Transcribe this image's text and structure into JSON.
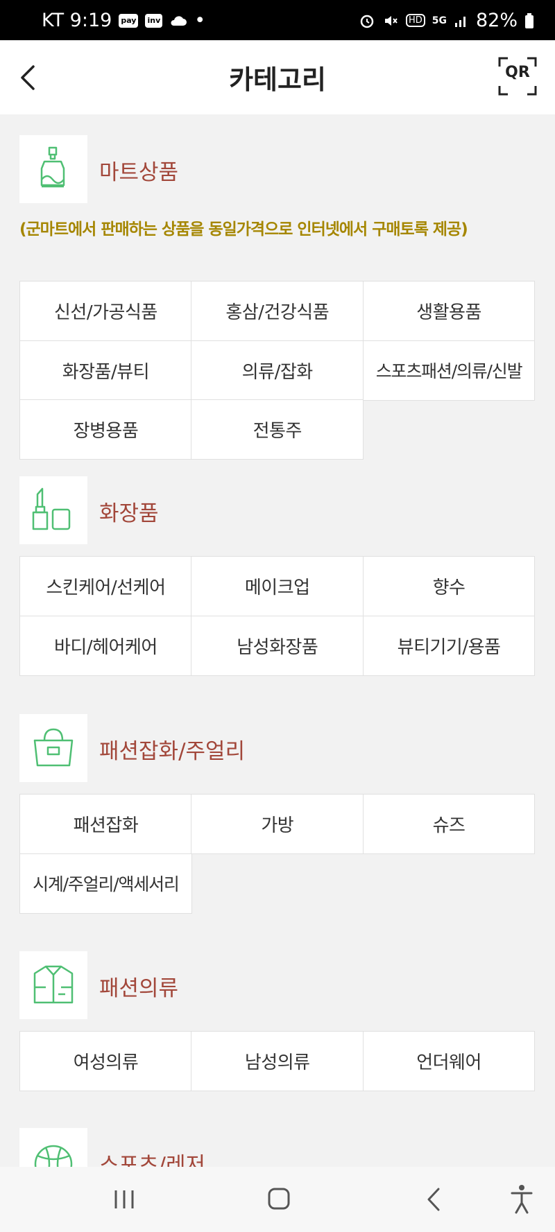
{
  "status_bar": {
    "carrier_time": "KT 9:19",
    "badge_pay": "pay",
    "badge_inv": "inv",
    "dot": "•",
    "hd": "HD",
    "network": "5G",
    "battery": "82%"
  },
  "header": {
    "title": "카테고리",
    "qr_label": "QR"
  },
  "sections": [
    {
      "title": "마트상품",
      "note": "(군마트에서 판매하는 상품을 동일가격으로 인터넷에서 구매토록 제공)",
      "items": [
        "신선/가공식품",
        "홍삼/건강식품",
        "생활용품",
        "화장품/뷰티",
        "의류/잡화",
        "스포츠패션/의류/신발",
        "장병용품",
        "전통주"
      ]
    },
    {
      "title": "화장품",
      "items": [
        "스킨케어/선케어",
        "메이크업",
        "향수",
        "바디/헤어케어",
        "남성화장품",
        "뷰티기기/용품"
      ]
    },
    {
      "title": "패션잡화/주얼리",
      "items": [
        "패션잡화",
        "가방",
        "슈즈",
        "시계/주얼리/액세서리"
      ]
    },
    {
      "title": "패션의류",
      "items": [
        "여성의류",
        "남성의류",
        "언더웨어"
      ]
    },
    {
      "title": "스포츠/레저",
      "items": []
    }
  ],
  "icons": [
    "mart-bottle-icon",
    "cosmetics-icon",
    "handbag-icon",
    "shirt-icon",
    "sports-ball-icon"
  ],
  "colors": {
    "section_title": "#a2473a",
    "note": "#a58600",
    "icon_green": "#4fbf73"
  }
}
